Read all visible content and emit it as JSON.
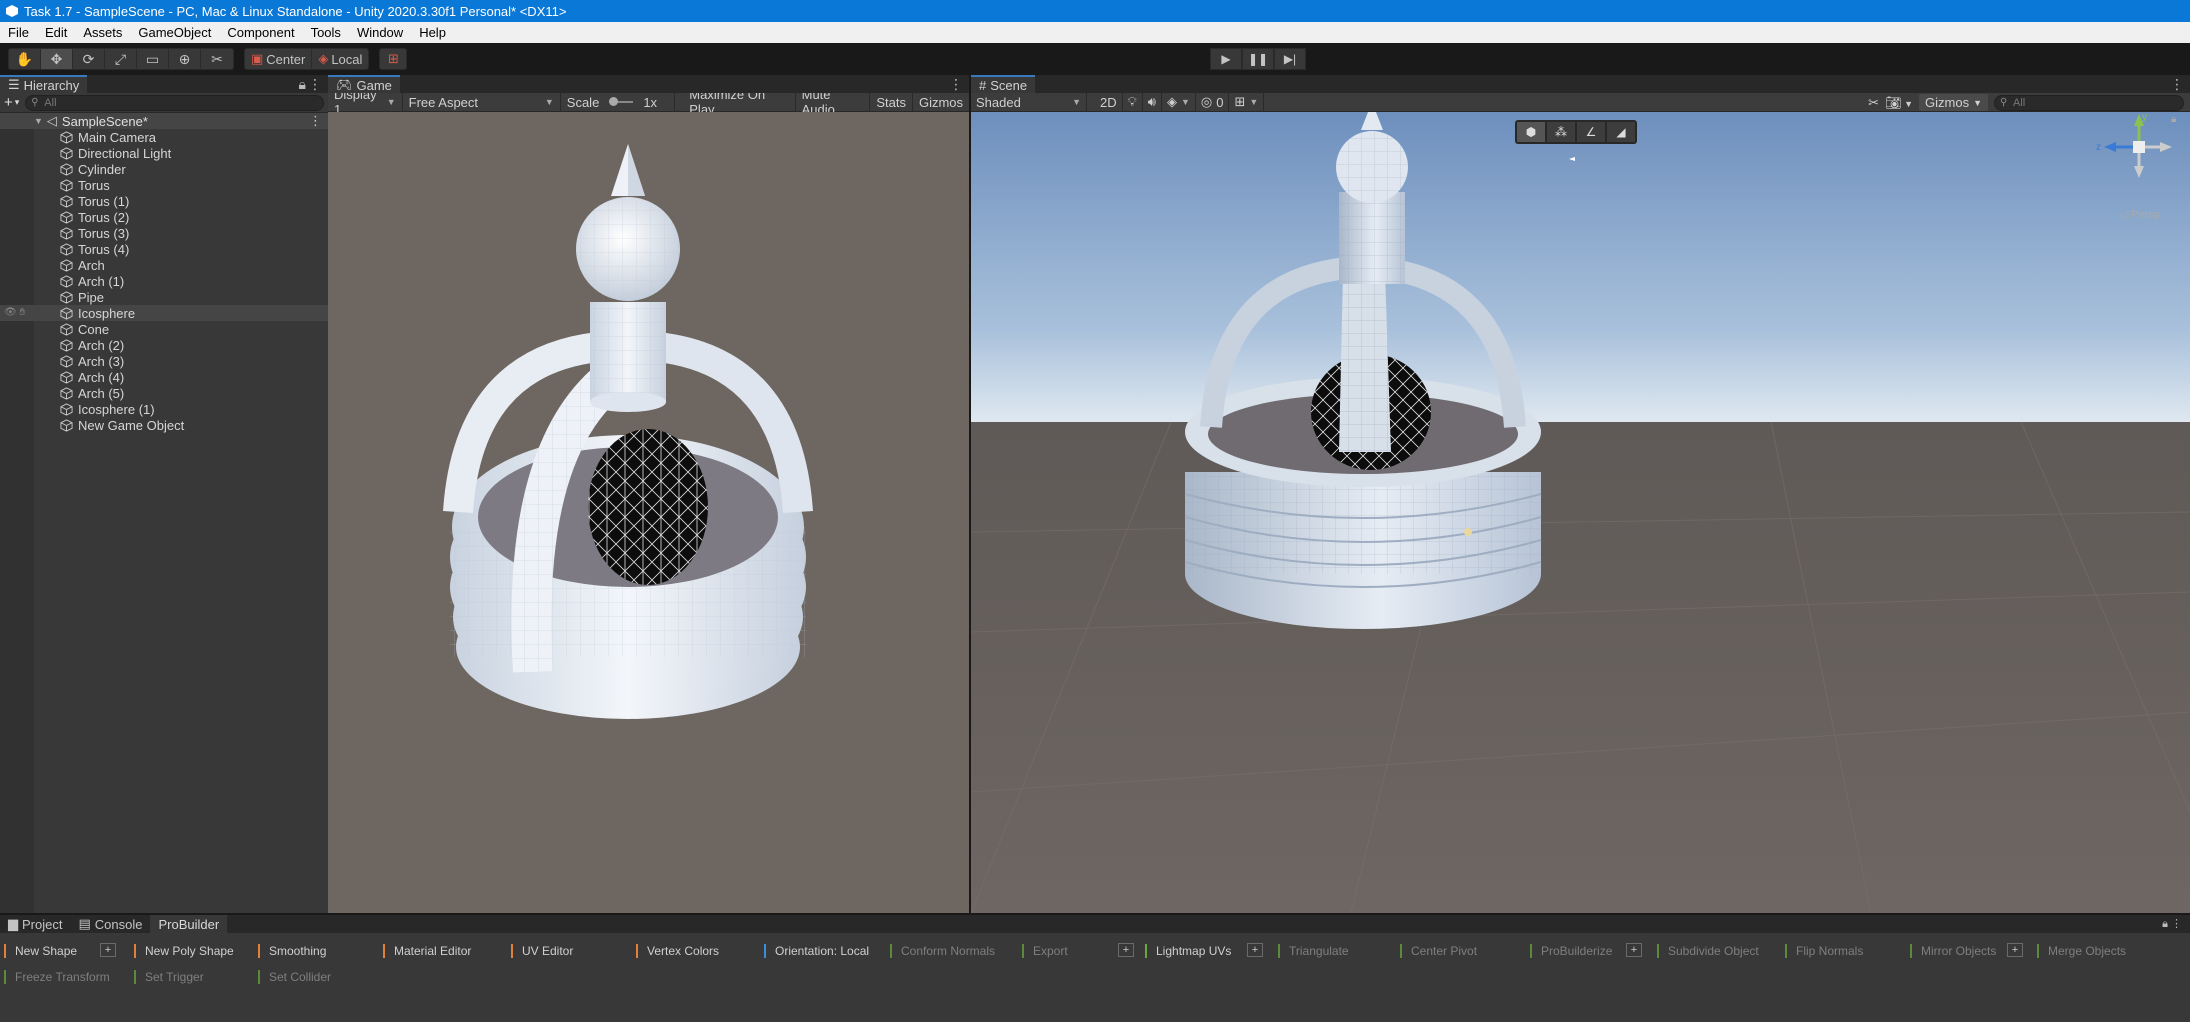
{
  "window": {
    "title": "Task 1.7 - SampleScene - PC, Mac & Linux Standalone - Unity 2020.3.30f1 Personal* <DX11>"
  },
  "menu": [
    "File",
    "Edit",
    "Assets",
    "GameObject",
    "Component",
    "Tools",
    "Window",
    "Help"
  ],
  "toolbar": {
    "tools": [
      "hand-tool-icon",
      "move-tool-icon",
      "rotate-tool-icon",
      "scale-tool-icon",
      "rect-tool-icon",
      "transform-tool-icon",
      "custom-tool-icon"
    ],
    "pivot_label": "Center",
    "space_label": "Local"
  },
  "hierarchy": {
    "tab_label": "Hierarchy",
    "search_placeholder": "All",
    "scene_name": "SampleScene*",
    "objects": [
      "Main Camera",
      "Directional Light",
      "Cylinder",
      "Torus",
      "Torus (1)",
      "Torus (2)",
      "Torus (3)",
      "Torus (4)",
      "Arch",
      "Arch (1)",
      "Pipe",
      "Icosphere",
      "Cone",
      "Arch (2)",
      "Arch (3)",
      "Arch (4)",
      "Arch (5)",
      "Icosphere (1)",
      "New Game Object"
    ],
    "selected_index": 11
  },
  "game": {
    "tab_label": "Game",
    "display": "Display 1",
    "aspect": "Free Aspect",
    "scale_label": "Scale",
    "scale_value": "1x",
    "maximize": "Maximize On Play",
    "mute": "Mute Audio",
    "stats": "Stats",
    "gizmos": "Gizmos"
  },
  "scene": {
    "tab_label": "Scene",
    "shading": "Shaded",
    "mode_2d": "2D",
    "hidden_count": "0",
    "gizmos": "Gizmos",
    "search_placeholder": "All",
    "persp_label": "Persp",
    "axis_y": "y",
    "axis_z": "z"
  },
  "bottom": {
    "tabs": [
      "Project",
      "Console",
      "ProBuilder"
    ],
    "row1": [
      {
        "label": "New Shape",
        "color": "#e0803a",
        "dim": false,
        "plus": true
      },
      {
        "label": "New Poly Shape",
        "color": "#e0803a",
        "dim": false,
        "plus": false
      },
      {
        "label": "Smoothing",
        "color": "#e0803a",
        "dim": false,
        "plus": false
      },
      {
        "label": "Material Editor",
        "color": "#e0803a",
        "dim": false,
        "plus": false
      },
      {
        "label": "UV Editor",
        "color": "#e0803a",
        "dim": false,
        "plus": false
      },
      {
        "label": "Vertex Colors",
        "color": "#e0803a",
        "dim": false,
        "plus": false
      },
      {
        "label": "Orientation: Local",
        "color": "#3a8fd8",
        "dim": false,
        "plus": false
      },
      {
        "label": "Conform Normals",
        "color": "#5a8a3a",
        "dim": true,
        "plus": false
      },
      {
        "label": "Export",
        "color": "#5a8a3a",
        "dim": true,
        "plus": true
      },
      {
        "label": "Lightmap UVs",
        "color": "#6aa83a",
        "dim": false,
        "plus": true
      },
      {
        "label": "Triangulate",
        "color": "#5a8a3a",
        "dim": true,
        "plus": false
      },
      {
        "label": "Center Pivot",
        "color": "#5a8a3a",
        "dim": true,
        "plus": false
      },
      {
        "label": "ProBuilderize",
        "color": "#5a8a3a",
        "dim": true,
        "plus": true
      },
      {
        "label": "Subdivide Object",
        "color": "#5a8a3a",
        "dim": true,
        "plus": false
      },
      {
        "label": "Flip Normals",
        "color": "#5a8a3a",
        "dim": true,
        "plus": false
      },
      {
        "label": "Mirror Objects",
        "color": "#5a8a3a",
        "dim": true,
        "plus": true
      },
      {
        "label": "Merge Objects",
        "color": "#5a8a3a",
        "dim": true,
        "plus": false
      }
    ],
    "row2": [
      {
        "label": "Freeze Transform",
        "color": "#5a8a3a",
        "dim": true
      },
      {
        "label": "Set Trigger",
        "color": "#5a8a3a",
        "dim": true
      },
      {
        "label": "Set Collider",
        "color": "#5a8a3a",
        "dim": true
      }
    ]
  }
}
